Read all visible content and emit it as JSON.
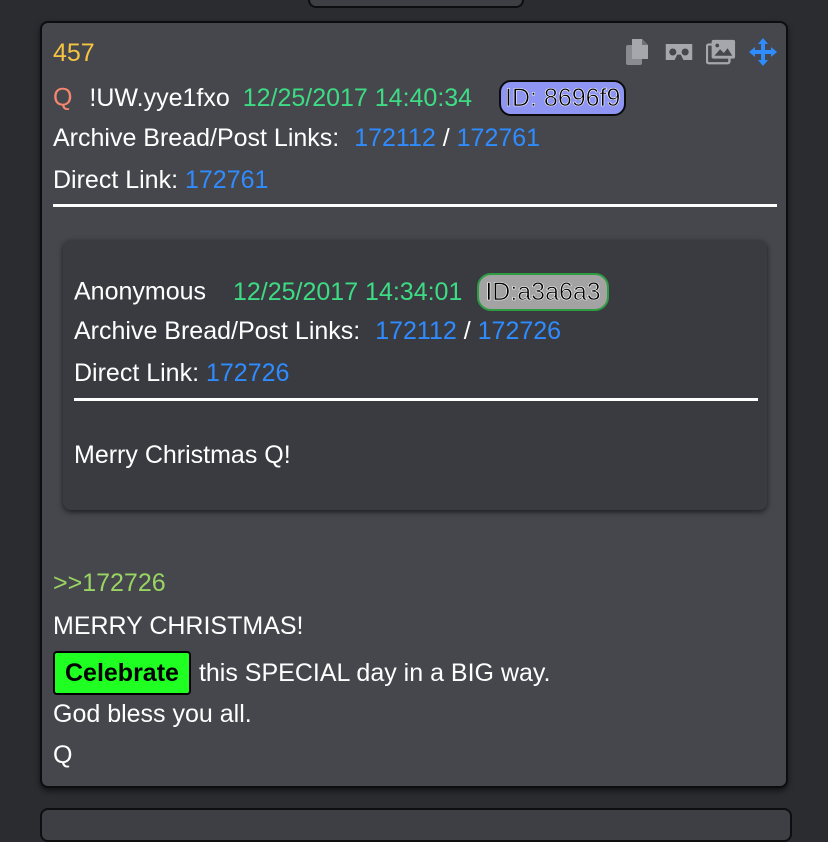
{
  "post": {
    "number": "457",
    "author_letter": "Q",
    "tripcode": "!UW.yye1fxo",
    "date": "12/25/2017 14:40:34",
    "id_badge": "ID: 8696f9",
    "archive_label": "Archive Bread/Post Links:",
    "archive_bread": "172112",
    "archive_sep": "/",
    "archive_post": "172761",
    "direct_label": "Direct Link:",
    "direct_link": "172761",
    "icons": [
      "copy-icon",
      "vr-headset-icon",
      "image-gallery-icon",
      "move-arrows-icon"
    ],
    "body": {
      "greentext": ">>172726",
      "line1": "MERRY CHRISTMAS!",
      "celebrate_label": "Celebrate",
      "line2_rest": "this SPECIAL day in a BIG way.",
      "line3": "God bless you all.",
      "signature": "Q"
    }
  },
  "quoted": {
    "author": "Anonymous",
    "date": "12/25/2017 14:34:01",
    "id_badge": "ID:a3a6a3",
    "archive_label": "Archive Bread/Post Links:",
    "archive_bread": "172112",
    "archive_sep": "/",
    "archive_post": "172726",
    "direct_label": "Direct Link:",
    "direct_link": "172726",
    "message": "Merry Christmas Q!"
  },
  "colors": {
    "background": "#2b2c30",
    "card": "#46474d",
    "quoted_card": "#3a3b40",
    "post_number": "#f5c542",
    "q_letter": "#f5876e",
    "date_green": "#3ddc84",
    "link_blue": "#2f8cff",
    "greentext": "#9ad462",
    "id_badge_main": "#8f95f2",
    "id_badge_quoted": "#a3a3a3",
    "celebrate_bg": "#1fff22"
  }
}
